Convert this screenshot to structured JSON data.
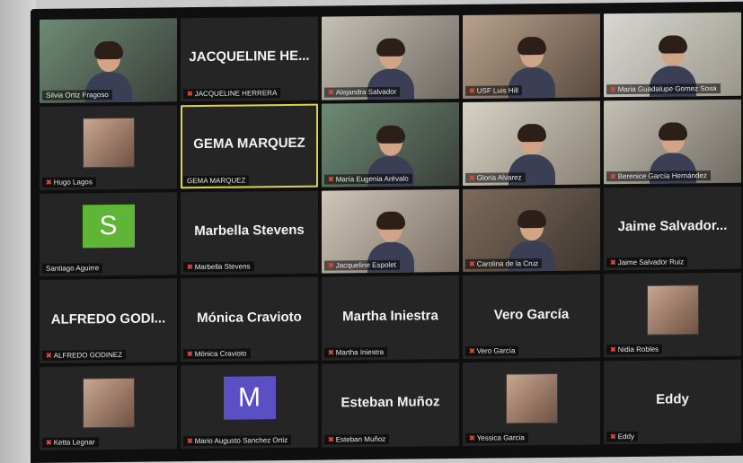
{
  "colors": {
    "active_border": "#d9d24a",
    "mute_icon": "#e0483a",
    "avatar_s": "#5fb535",
    "avatar_m": "#5b4fc4"
  },
  "tiles": [
    {
      "name": "Silvia Ortiz Fragoso",
      "display": "",
      "kind": "video",
      "muted": false
    },
    {
      "name": "JACQUELINE HERRERA",
      "display": "JACQUELINE HE...",
      "kind": "name",
      "muted": true
    },
    {
      "name": "Alejandra Salvador",
      "display": "",
      "kind": "video",
      "muted": true
    },
    {
      "name": "USF Luis Hill",
      "display": "",
      "kind": "video",
      "muted": true
    },
    {
      "name": "Maria Guadalupe Gomez Sosa",
      "display": "",
      "kind": "video",
      "muted": true
    },
    {
      "name": "Hugo Lagos",
      "display": "",
      "kind": "thumb",
      "muted": true
    },
    {
      "name": "GEMA MARQUEZ",
      "display": "GEMA MARQUEZ",
      "kind": "name",
      "muted": false,
      "active": true
    },
    {
      "name": "María Eugenia Arévalo",
      "display": "",
      "kind": "video",
      "muted": true
    },
    {
      "name": "Gloria Alvarez",
      "display": "",
      "kind": "video",
      "muted": true
    },
    {
      "name": "Berenice García Hernández",
      "display": "",
      "kind": "video",
      "muted": true
    },
    {
      "name": "Santiago Aguirre",
      "display": "",
      "kind": "avatar",
      "letter": "S",
      "muted": false
    },
    {
      "name": "Marbella Stevens",
      "display": "Marbella Stevens",
      "kind": "name",
      "muted": true
    },
    {
      "name": "Jacqueline Espolet",
      "display": "",
      "kind": "video",
      "muted": true
    },
    {
      "name": "Carolina de la Cruz",
      "display": "",
      "kind": "video",
      "muted": true
    },
    {
      "name": "Jaime Salvador Ruiz",
      "display": "Jaime Salvador...",
      "kind": "name",
      "muted": true
    },
    {
      "name": "ALFREDO GODINEZ",
      "display": "ALFREDO GODI...",
      "kind": "name",
      "muted": true
    },
    {
      "name": "Mónica Cravioto",
      "display": "Mónica Cravioto",
      "kind": "name",
      "muted": true
    },
    {
      "name": "Martha Iniestra",
      "display": "Martha Iniestra",
      "kind": "name",
      "muted": true
    },
    {
      "name": "Vero García",
      "display": "Vero García",
      "kind": "name",
      "muted": true
    },
    {
      "name": "Nidia Robles",
      "display": "",
      "kind": "thumb",
      "muted": true
    },
    {
      "name": "Ketta Legnar",
      "display": "",
      "kind": "thumb",
      "muted": true
    },
    {
      "name": "Mario Augusto Sanchez Ortiz",
      "display": "",
      "kind": "avatar",
      "letter": "M",
      "muted": true
    },
    {
      "name": "Esteban Muñoz",
      "display": "Esteban Muñoz",
      "kind": "name",
      "muted": true
    },
    {
      "name": "Yessica Garcia",
      "display": "",
      "kind": "thumb",
      "muted": true
    },
    {
      "name": "Eddy",
      "display": "Eddy",
      "kind": "name",
      "muted": true
    }
  ]
}
